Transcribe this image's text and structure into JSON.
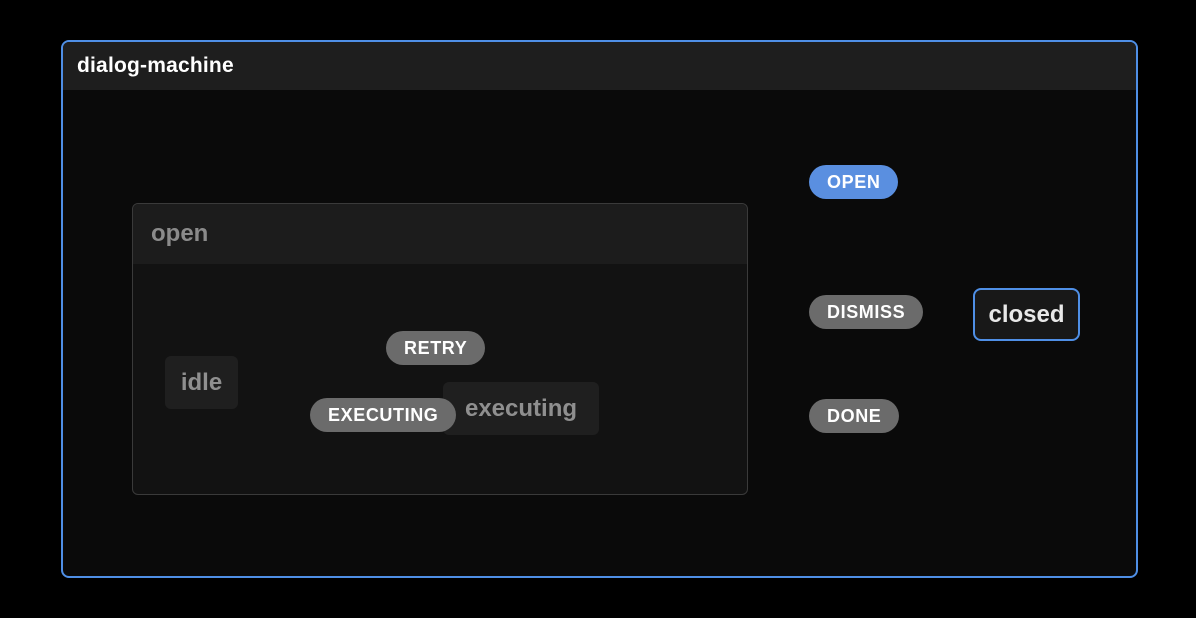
{
  "machine": {
    "title": "dialog-machine"
  },
  "states": {
    "open": {
      "label": "open"
    },
    "idle": {
      "label": "idle"
    },
    "executing": {
      "label": "executing"
    },
    "closed": {
      "label": "closed"
    }
  },
  "events": {
    "open": {
      "label": "OPEN"
    },
    "dismiss": {
      "label": "DISMISS"
    },
    "retry": {
      "label": "RETRY"
    },
    "executing": {
      "label": "EXECUTING"
    },
    "done": {
      "label": "DONE"
    }
  },
  "transitions": [
    {
      "from": "closed",
      "event": "OPEN",
      "to": "open"
    },
    {
      "from": "open",
      "event": "DISMISS",
      "to": "closed"
    },
    {
      "from": "open.idle",
      "event": "EXECUTING",
      "to": "open.executing"
    },
    {
      "from": "open.executing",
      "event": "RETRY",
      "to": "open.idle"
    },
    {
      "from": "open.executing",
      "event": "DONE",
      "to": "closed"
    }
  ],
  "colors": {
    "accent": "#4f8fe6",
    "event_pill": "#6b6b6b",
    "event_pill_highlight": "#5a8fe0",
    "bg": "#000000",
    "muted_text": "#8f8f8f"
  }
}
